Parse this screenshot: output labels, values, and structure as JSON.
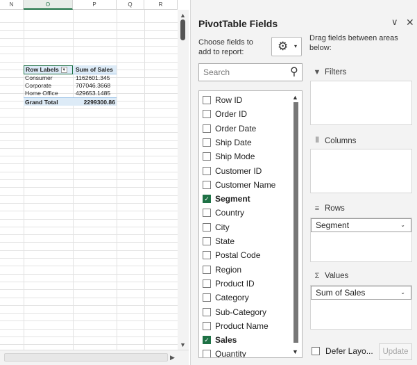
{
  "sheet": {
    "columns": [
      "N",
      "O",
      "P",
      "Q",
      "R"
    ],
    "active_column": "O",
    "pivot": {
      "header": {
        "row_labels": "Row Labels",
        "sum_label": "Sum of Sales",
        "filter_glyph": "▼"
      },
      "rows": [
        {
          "label": "Consumer",
          "value": "1162601.345"
        },
        {
          "label": "Corporate",
          "value": "707046.3668"
        },
        {
          "label": "Home Office",
          "value": "429653.1485"
        }
      ],
      "total": {
        "label": "Grand Total",
        "value": "2299300.86"
      }
    }
  },
  "pane": {
    "title": "PivotTable Fields",
    "collapse_glyph": "∨",
    "close_glyph": "✕",
    "choose_label": "Choose fields to add to report:",
    "search": {
      "placeholder": "Search"
    },
    "fields": [
      {
        "label": "Row ID",
        "checked": false
      },
      {
        "label": "Order ID",
        "checked": false
      },
      {
        "label": "Order Date",
        "checked": false
      },
      {
        "label": "Ship Date",
        "checked": false
      },
      {
        "label": "Ship Mode",
        "checked": false
      },
      {
        "label": "Customer ID",
        "checked": false
      },
      {
        "label": "Customer Name",
        "checked": false
      },
      {
        "label": "Segment",
        "checked": true
      },
      {
        "label": "Country",
        "checked": false
      },
      {
        "label": "City",
        "checked": false
      },
      {
        "label": "State",
        "checked": false
      },
      {
        "label": "Postal Code",
        "checked": false
      },
      {
        "label": "Region",
        "checked": false
      },
      {
        "label": "Product ID",
        "checked": false
      },
      {
        "label": "Category",
        "checked": false
      },
      {
        "label": "Sub-Category",
        "checked": false
      },
      {
        "label": "Product Name",
        "checked": false
      },
      {
        "label": "Sales",
        "checked": true
      },
      {
        "label": "Quantity",
        "checked": false
      }
    ],
    "drag_label": "Drag fields between areas below:",
    "areas": {
      "filters": {
        "label": "Filters",
        "icon": "filter-icon"
      },
      "columns": {
        "label": "Columns",
        "icon": "columns-icon"
      },
      "rows": {
        "label": "Rows",
        "icon": "rows-icon",
        "item": "Segment"
      },
      "values": {
        "label": "Values",
        "icon": "sigma-icon",
        "item": "Sum of Sales"
      }
    },
    "defer_label": "Defer Layo...",
    "update_label": "Update"
  },
  "colors": {
    "accent": "#1e7145",
    "pivot_header": "#ddebf7",
    "pane_bg": "#f3f3f3"
  }
}
